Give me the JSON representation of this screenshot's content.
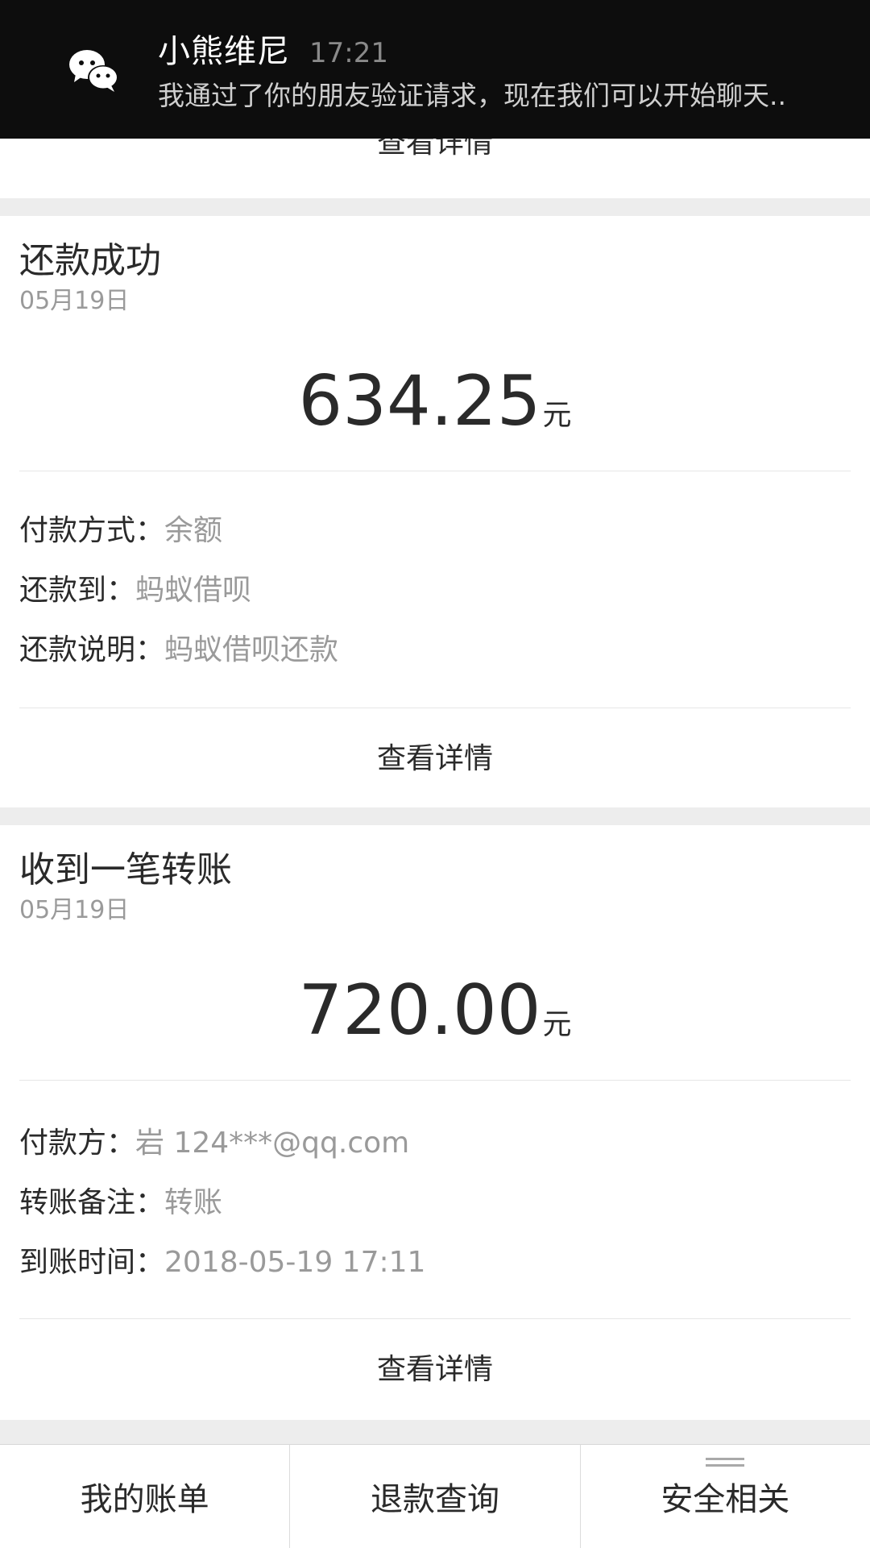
{
  "notification": {
    "sender": "小熊维尼",
    "time": "17:21",
    "message": "我通过了你的朋友验证请求，现在我们可以开始聊天..",
    "icon": "wechat-icon"
  },
  "partial_card": {
    "detail_label": "查看详情"
  },
  "cards": [
    {
      "title": "还款成功",
      "date": "05月19日",
      "amount": "634.25",
      "unit": "元",
      "rows": [
        {
          "label": "付款方式：",
          "value": "余额"
        },
        {
          "label": "还款到：",
          "value": "蚂蚁借呗"
        },
        {
          "label": "还款说明：",
          "value": "蚂蚁借呗还款"
        }
      ],
      "detail_label": "查看详情"
    },
    {
      "title": "收到一笔转账",
      "date": "05月19日",
      "amount": "720.00",
      "unit": "元",
      "rows": [
        {
          "label": "付款方：",
          "value": "岩 124***@qq.com"
        },
        {
          "label": "转账备注：",
          "value": "转账"
        },
        {
          "label": "到账时间：",
          "value": "2018-05-19 17:11"
        }
      ],
      "detail_label": "查看详情"
    }
  ],
  "bottom_nav": {
    "items": [
      {
        "label": "我的账单"
      },
      {
        "label": "退款查询"
      },
      {
        "label": "安全相关",
        "icon": "menu-icon"
      }
    ]
  },
  "colors": {
    "notification_bg": "#0d0d0d",
    "page_bg": "#ededed",
    "card_bg": "#ffffff",
    "primary_text": "#2a2a2a",
    "secondary_text": "#9a9a9a"
  }
}
